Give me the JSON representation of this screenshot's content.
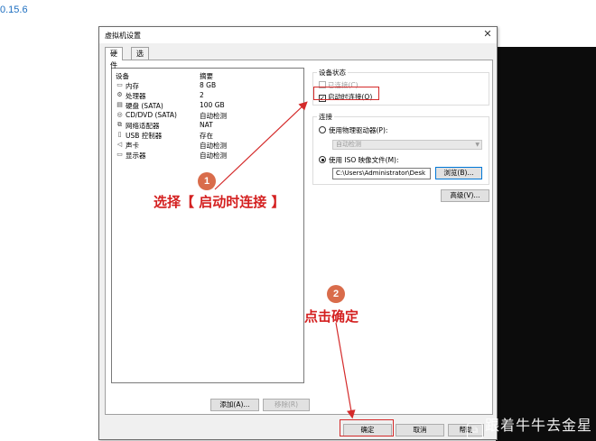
{
  "header": {
    "version_text": "0.15.6"
  },
  "dialog": {
    "title": "虚拟机设置",
    "close_glyph": "✕",
    "tabs": [
      {
        "label": "硬件"
      },
      {
        "label": "选项"
      }
    ],
    "device_list": {
      "col_device": "设备",
      "col_summary": "摘要",
      "rows": [
        {
          "icon": "memory-icon",
          "glyph": "▭",
          "name": "内存",
          "summary": "8 GB"
        },
        {
          "icon": "processor-icon",
          "glyph": "⚙",
          "name": "处理器",
          "summary": "2"
        },
        {
          "icon": "hard-disk-icon",
          "glyph": "▤",
          "name": "硬盘 (SATA)",
          "summary": "100 GB"
        },
        {
          "icon": "cd-dvd-icon",
          "glyph": "◎",
          "name": "CD/DVD (SATA)",
          "summary": "自动检测"
        },
        {
          "icon": "network-adapter-icon",
          "glyph": "⧉",
          "name": "网络适配器",
          "summary": "NAT"
        },
        {
          "icon": "usb-icon",
          "glyph": "▯",
          "name": "USB 控制器",
          "summary": "存在"
        },
        {
          "icon": "sound-card-icon",
          "glyph": "◁",
          "name": "声卡",
          "summary": "自动检测"
        },
        {
          "icon": "display-icon",
          "glyph": "▭",
          "name": "显示器",
          "summary": "自动检测"
        }
      ],
      "add_button": "添加(A)...",
      "remove_button": "移除(R)"
    },
    "device_status": {
      "group_label": "设备状态",
      "connected_label": "已连接(C)",
      "connect_at_power_on_label": "启动时连接(O)",
      "connect_at_power_on_checked": true
    },
    "connection": {
      "group_label": "连接",
      "physical_drive_label": "使用物理驱动器(P):",
      "physical_drive_value": "自动检测",
      "iso_label": "使用 ISO 映像文件(M):",
      "iso_path": "C:\\Users\\Administrator\\Desk",
      "browse_button": "浏览(B)...",
      "selected": "iso"
    },
    "advanced_button": "高级(V)...",
    "ok_button": "确定",
    "cancel_button": "取消",
    "help_button": "帮助"
  },
  "annotations": {
    "step1_number": "1",
    "step1_text": "选择【 启动时连接 】",
    "step2_number": "2",
    "step2_text": "点击确定",
    "color": "#d42a2a"
  },
  "watermark": {
    "logo_glyph": "⧉",
    "text": "跟着牛牛去金星"
  }
}
